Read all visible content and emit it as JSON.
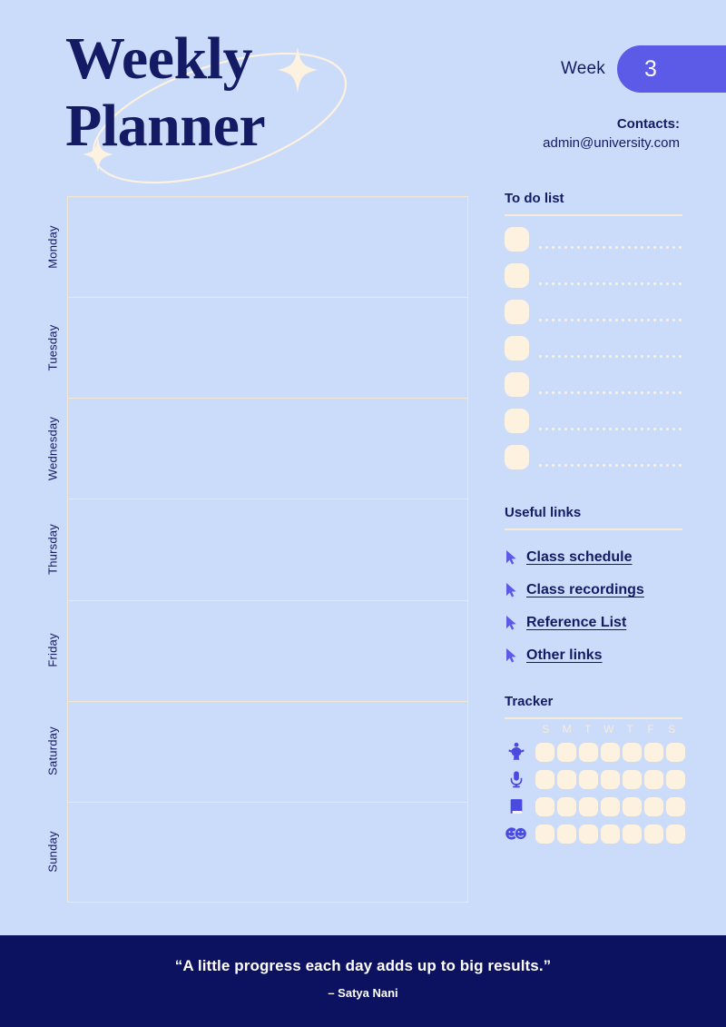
{
  "header": {
    "title": "Weekly\nPlanner",
    "week_label": "Week",
    "week_number": "3",
    "contacts_label": "Contacts:",
    "contacts_value": "admin@university.com"
  },
  "days": [
    {
      "label": "Monday"
    },
    {
      "label": "Tuesday"
    },
    {
      "label": "Wednesday"
    },
    {
      "label": "Thursday"
    },
    {
      "label": "Friday"
    },
    {
      "label": "Saturday"
    },
    {
      "label": "Sunday"
    }
  ],
  "todo": {
    "heading": "To do list",
    "items": [
      "",
      "",
      "",
      "",
      "",
      "",
      ""
    ]
  },
  "links": {
    "heading": "Useful links",
    "items": [
      {
        "label": "Class schedule",
        "icon": "cursor-arrow-icon"
      },
      {
        "label": "Class recordings",
        "icon": "cursor-arrow-icon"
      },
      {
        "label": "Reference List",
        "icon": "cursor-arrow-icon"
      },
      {
        "label": "Other links",
        "icon": "cursor-arrow-icon"
      }
    ]
  },
  "tracker": {
    "heading": "Tracker",
    "day_initials": [
      "S",
      "M",
      "T",
      "W",
      "T",
      "F",
      "S"
    ],
    "rows": [
      {
        "icon": "exercise-person-icon",
        "cells": [
          false,
          false,
          false,
          false,
          false,
          false,
          false
        ]
      },
      {
        "icon": "microphone-icon",
        "cells": [
          false,
          false,
          false,
          false,
          false,
          false,
          false
        ]
      },
      {
        "icon": "book-icon",
        "cells": [
          false,
          false,
          false,
          false,
          false,
          false,
          false
        ]
      },
      {
        "icon": "smiley-faces-icon",
        "cells": [
          false,
          false,
          false,
          false,
          false,
          false,
          false
        ]
      }
    ]
  },
  "footer": {
    "quote": "“A little progress each day adds up to big results.”",
    "author": "– Satya Nani"
  },
  "colors": {
    "background": "#CBDCFA",
    "navy": "#141A63",
    "navy_deep": "#0C1160",
    "purple": "#5B5BE8",
    "cream": "#FDF1E0"
  }
}
